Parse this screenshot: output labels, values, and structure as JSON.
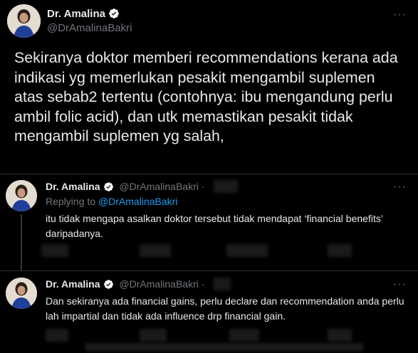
{
  "main_tweet": {
    "name": "Dr. Amalina",
    "handle": "@DrAmalinaBakri",
    "text": "Sekiranya doktor memberi recommendations kerana ada indikasi yg memerlukan pesakit mengambil suplemen atas sebab2 tertentu (contohnya: ibu mengandung perlu ambil folic acid), dan utk memastikan pesakit tidak mengambil suplemen yg salah,"
  },
  "reply1": {
    "name": "Dr. Amalina",
    "handle": "@DrAmalinaBakri",
    "dot": "·",
    "replying_prefix": "Replying to ",
    "replying_handle": "@DrAmalinaBakri",
    "text": "itu tidak mengapa asalkan doktor tersebut tidak mendapat ‘financial benefits’ daripadanya."
  },
  "reply2": {
    "name": "Dr. Amalina",
    "handle": "@DrAmalinaBakri",
    "dot": "·",
    "text": "Dan sekiranya ada financial gains, perlu declare dan recommendation anda perlu lah impartial dan tidak ada influence drp financial gain."
  },
  "more_label": "···",
  "colors": {
    "background": "#000000",
    "text": "#e7e9ea",
    "muted": "#71767b",
    "link": "#1d9bf0",
    "verified": "#ffffff"
  }
}
